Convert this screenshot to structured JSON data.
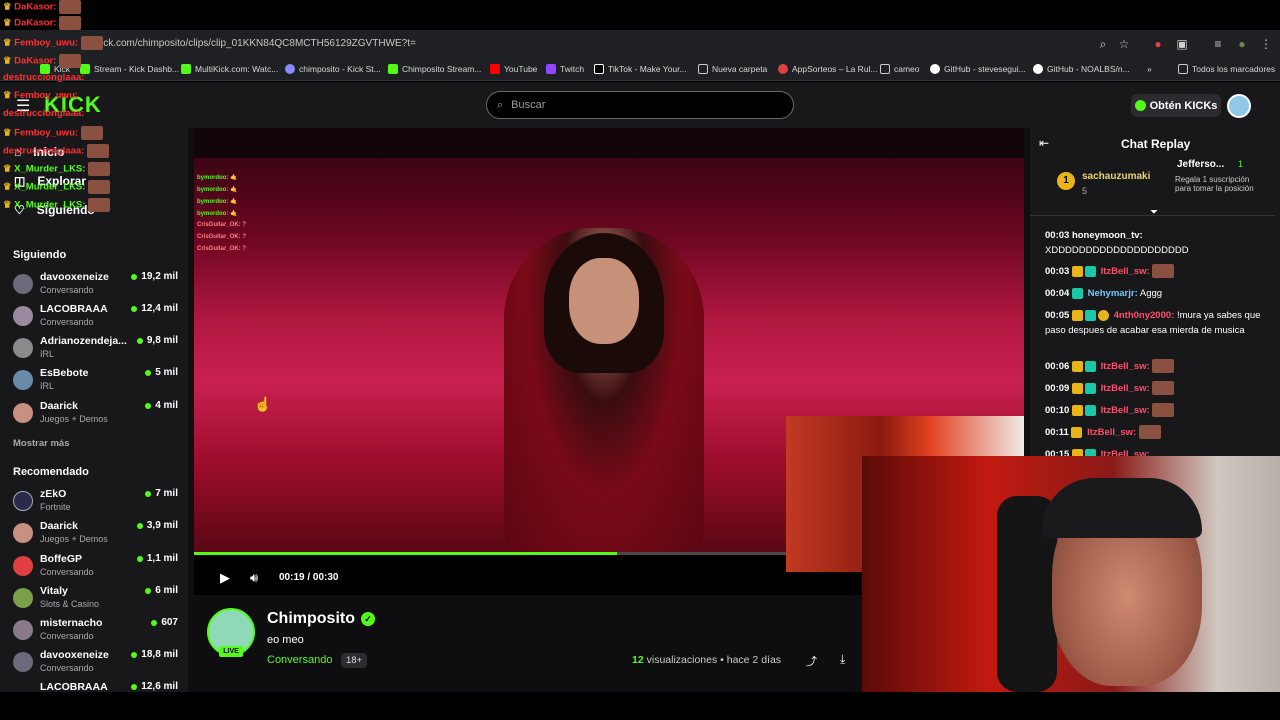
{
  "browser": {
    "url": "kick.com/chimposito/clips/clip_01KKN84QC8MCTH56129ZGVTHWE?t=",
    "bookmarks": [
      "Kick",
      "Stream - Kick Dashb...",
      "MultiKick.com: Watc...",
      "chimposito - Kick St...",
      "Chimposito Stream...",
      "YouTube",
      "Twitch",
      "TikTok - Make Your...",
      "Nueva carpeta",
      "AppSorteos – La Rul...",
      "cameo",
      "GitHub - stevesegui...",
      "GitHub - NOALBS/n...",
      "»",
      "Todos los marcadores"
    ]
  },
  "header": {
    "logo": "KICK",
    "search_placeholder": "Buscar",
    "get_kicks": "Obtén KICKs"
  },
  "nav": {
    "items": [
      "Inicio",
      "Explorar",
      "Siguiendo"
    ]
  },
  "sidebar": {
    "following_title": "Siguiendo",
    "following": [
      {
        "name": "davooxeneize",
        "category": "Conversando",
        "viewers": "19,2 mil"
      },
      {
        "name": "LACOBRAAA",
        "category": "Conversando",
        "viewers": "12,4 mil"
      },
      {
        "name": "Adrianozendeja...",
        "category": "IRL",
        "viewers": "9,8 mil"
      },
      {
        "name": "EsBebote",
        "category": "IRL",
        "viewers": "5 mil"
      },
      {
        "name": "Daarick",
        "category": "Juegos + Demos",
        "viewers": "4 mil"
      }
    ],
    "show_more": "Mostrar más",
    "recommended_title": "Recomendado",
    "recommended": [
      {
        "name": "zEkO",
        "category": "Fortnite",
        "viewers": "7 mil"
      },
      {
        "name": "Daarick",
        "category": "Juegos + Demos",
        "viewers": "3,9 mil"
      },
      {
        "name": "BoffeGP",
        "category": "Conversando",
        "viewers": "1,1 mil"
      },
      {
        "name": "Vitaly",
        "category": "Slots & Casino",
        "viewers": "6 mil"
      },
      {
        "name": "misternacho",
        "category": "Conversando",
        "viewers": "607"
      },
      {
        "name": "davooxeneize",
        "category": "Conversando",
        "viewers": "18,8 mil"
      },
      {
        "name": "LACOBRAAA",
        "category": "",
        "viewers": "12,6 mil"
      }
    ]
  },
  "player": {
    "time": "00:19 / 00:30",
    "progress": 0.633,
    "overlay_chat": [
      "bymordoo: 🤙",
      "bymordoo: 🤙",
      "bymordoo: 🤙",
      "bymordoo: 🤙",
      "CrisGuitar_OK: ?",
      "CrisGuitar_OK: ?",
      "CrisGuitar_OK: ?"
    ]
  },
  "channel": {
    "name": "Chimposito",
    "clip_title": "eo meo",
    "category": "Conversando",
    "age_rating": "18+",
    "live_badge": "LIVE",
    "views_count": "12",
    "views_label": "visualizaciones",
    "time_ago": "• hace 2 días"
  },
  "chat": {
    "title": "Chat Replay",
    "pinned_user": "sachauzumaki",
    "pinned_count": "5",
    "pinned_right_user": "Jefferso...",
    "pinned_right_count": "1",
    "pinned_right_text": "Regala 1 suscripción para tomar la posición",
    "messages": [
      {
        "ts": "00:03",
        "user": "honeymoon_tv:",
        "text": "XDDDDDDDDDDDDDDDDDDDD",
        "color": "#ffffff"
      },
      {
        "ts": "00:03",
        "user": "ItzBell_sw:",
        "text": "",
        "color": "#ff4d6a"
      },
      {
        "ts": "00:04",
        "user": "Nehymarjr:",
        "text": "Aggg",
        "color": "#74c8ff"
      },
      {
        "ts": "00:05",
        "user": "4nth0ny2000:",
        "text": "!mura ya sabes que paso despues de acabar esa mierda de musica",
        "color": "#ff4d6a"
      },
      {
        "ts": "00:06",
        "user": "ItzBell_sw:",
        "text": "",
        "color": "#ff4d6a"
      },
      {
        "ts": "00:09",
        "user": "ItzBell_sw:",
        "text": "",
        "color": "#ff4d6a"
      },
      {
        "ts": "00:10",
        "user": "ItzBell_sw:",
        "text": "",
        "color": "#ff4d6a"
      },
      {
        "ts": "00:11",
        "user": "ItzBell_sw:",
        "text": "",
        "color": "#ff4d6a"
      },
      {
        "ts": "00:15",
        "user": "ItzBell_sw:",
        "text": "",
        "color": "#ff4d6a"
      }
    ]
  },
  "stream_overlay": {
    "lines": [
      {
        "text": "DaKasor:",
        "color": "#ff3030"
      },
      {
        "text": "DaKasor:",
        "color": "#ff3030"
      },
      {
        "text": "Femboy_uwu:",
        "color": "#ff3030"
      },
      {
        "text": "DaKasor:",
        "color": "#ff3030"
      },
      {
        "text": "destruccionglaaa:",
        "color": "#ff3030"
      },
      {
        "text": "Femboy_uwu:",
        "color": "#ff3030"
      },
      {
        "text": "destruccionglaaa:",
        "color": "#ff3030"
      },
      {
        "text": "Femboy_uwu:",
        "color": "#ff3030"
      },
      {
        "text": "destruccionglaaa:",
        "color": "#ff3030"
      },
      {
        "text": "X_Murder_LKS:",
        "color": "#53fc18"
      },
      {
        "text": "X_Murder_LKS:",
        "color": "#53fc18"
      },
      {
        "text": "X_Murder_LKS:",
        "color": "#53fc18"
      }
    ]
  },
  "colors": {
    "accent": "#53fc18",
    "bg": "#0e0e10",
    "panel": "#18181b"
  }
}
